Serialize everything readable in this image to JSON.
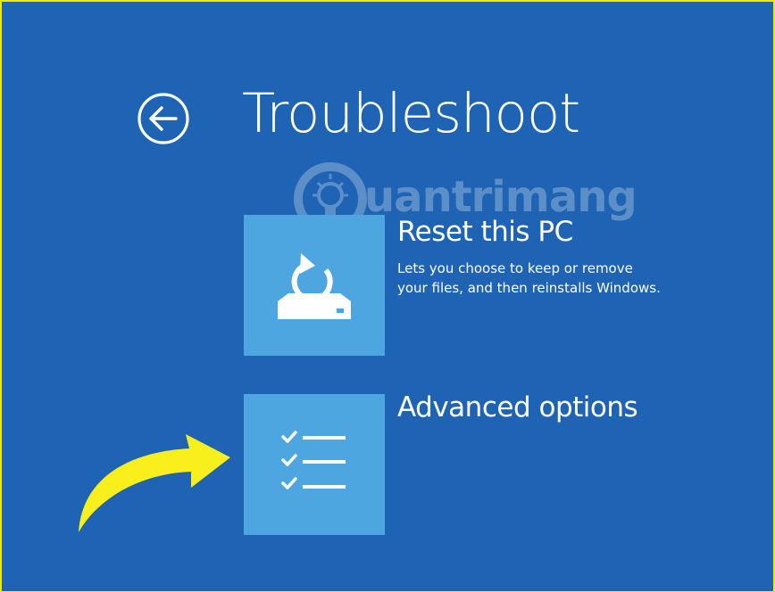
{
  "header": {
    "title": "Troubleshoot",
    "back_icon": "back-arrow-circle-icon"
  },
  "options": [
    {
      "title": "Reset this PC",
      "description_line1": "Lets you choose to keep or remove",
      "description_line2": "your files, and then reinstalls Windows.",
      "icon": "reset-pc-icon"
    },
    {
      "title": "Advanced options",
      "icon": "checklist-icon"
    }
  ],
  "watermark": {
    "text": "uantrimang",
    "logo": "quantrimang-logo"
  },
  "annotation": {
    "icon": "yellow-curved-arrow"
  },
  "colors": {
    "background": "#1e63b4",
    "tile": "#4da6e0",
    "frame_border": "#f3e600",
    "arrow": "#f8ef1c"
  }
}
